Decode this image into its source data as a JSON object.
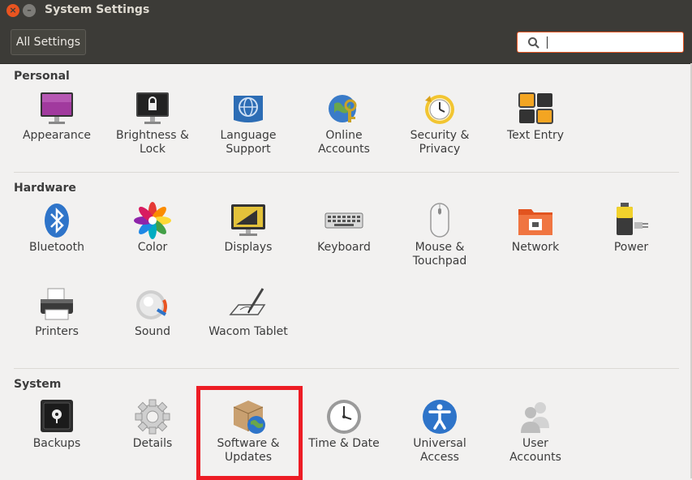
{
  "window": {
    "title": "System Settings",
    "close_symbol": "×",
    "minimize_symbol": "–"
  },
  "toolbar": {
    "all_settings_label": "All Settings",
    "search_value": ""
  },
  "sections": {
    "personal": {
      "heading": "Personal",
      "items": [
        {
          "label": "Appearance",
          "icon": "appearance-icon"
        },
        {
          "label": "Brightness &\nLock",
          "icon": "brightness-lock-icon"
        },
        {
          "label": "Language\nSupport",
          "icon": "language-icon"
        },
        {
          "label": "Online\nAccounts",
          "icon": "online-accounts-icon"
        },
        {
          "label": "Security &\nPrivacy",
          "icon": "security-privacy-icon"
        },
        {
          "label": "Text Entry",
          "icon": "text-entry-icon"
        }
      ]
    },
    "hardware": {
      "heading": "Hardware",
      "items": [
        {
          "label": "Bluetooth",
          "icon": "bluetooth-icon"
        },
        {
          "label": "Color",
          "icon": "color-icon"
        },
        {
          "label": "Displays",
          "icon": "displays-icon"
        },
        {
          "label": "Keyboard",
          "icon": "keyboard-icon"
        },
        {
          "label": "Mouse &\nTouchpad",
          "icon": "mouse-icon"
        },
        {
          "label": "Network",
          "icon": "network-icon"
        },
        {
          "label": "Power",
          "icon": "power-icon"
        },
        {
          "label": "Printers",
          "icon": "printer-icon"
        },
        {
          "label": "Sound",
          "icon": "sound-icon"
        },
        {
          "label": "Wacom Tablet",
          "icon": "wacom-tablet-icon"
        }
      ]
    },
    "system": {
      "heading": "System",
      "items": [
        {
          "label": "Backups",
          "icon": "backups-icon"
        },
        {
          "label": "Details",
          "icon": "details-icon"
        },
        {
          "label": "Software &\nUpdates",
          "icon": "software-updates-icon"
        },
        {
          "label": "Time & Date",
          "icon": "clock-icon"
        },
        {
          "label": "Universal\nAccess",
          "icon": "universal-access-icon"
        },
        {
          "label": "User\nAccounts",
          "icon": "user-accounts-icon"
        }
      ]
    }
  },
  "colors": {
    "accent": "#e95420",
    "titlebar": "#3c3b37",
    "highlight_box": "#ed1c24"
  }
}
